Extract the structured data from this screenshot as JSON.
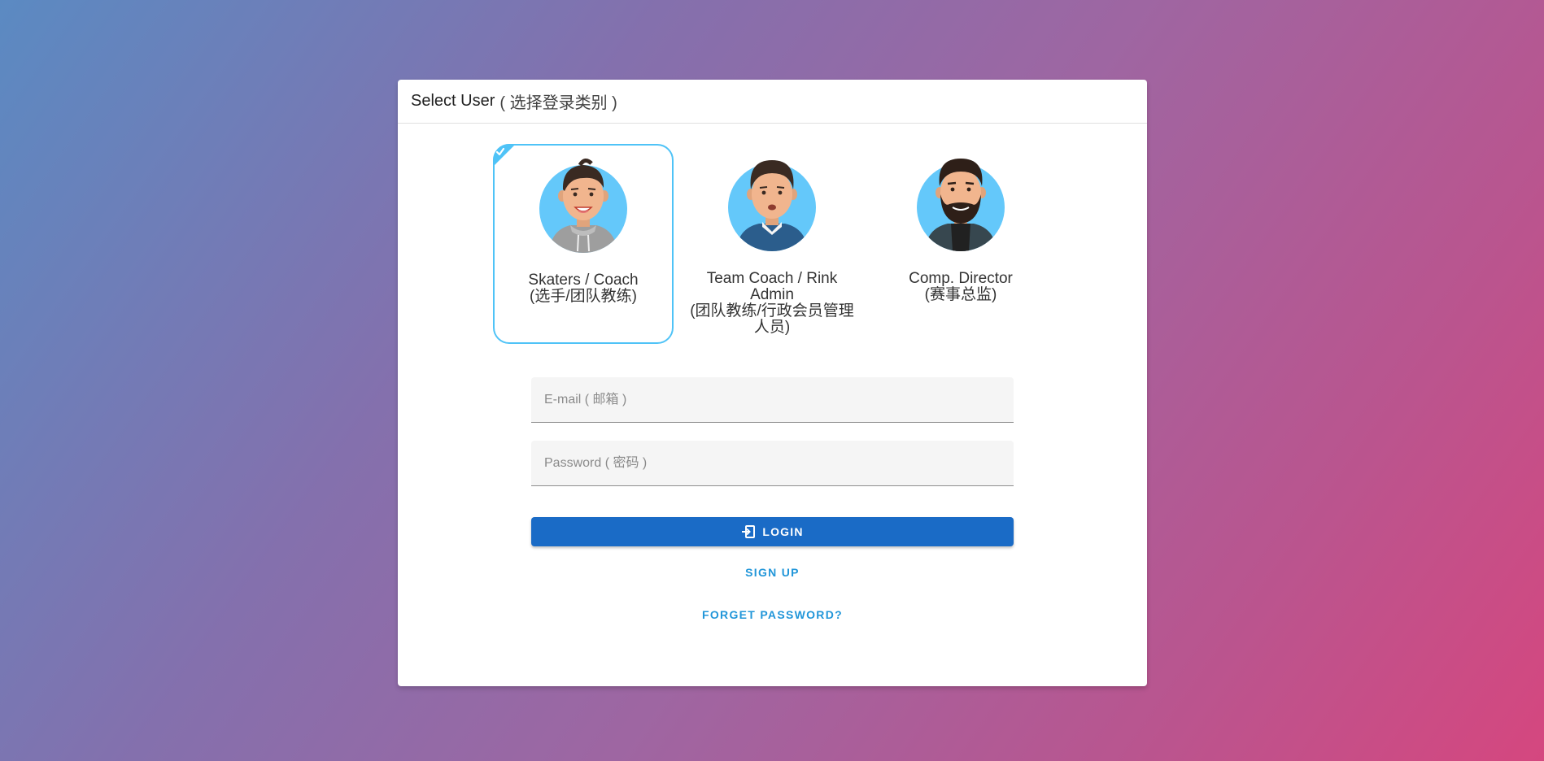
{
  "header": {
    "title": "Select User",
    "subtitle": "( 选择登录类别 )"
  },
  "users": [
    {
      "line1": "Skaters / Coach",
      "line2": "(选手/团队教练)",
      "selected": true,
      "avatar": "young-man-hoodie-avatar"
    },
    {
      "line1": "Team Coach / Rink Admin",
      "line2": "(团队教练/行政会员管理人员)",
      "selected": false,
      "avatar": "man-collared-shirt-avatar"
    },
    {
      "line1": "Comp. Director",
      "line2": "(赛事总监)",
      "selected": false,
      "avatar": "bearded-man-avatar"
    }
  ],
  "form": {
    "email_placeholder": "E-mail ( 邮箱 )",
    "password_placeholder": "Password ( 密码 )",
    "login_label": "LOGIN",
    "signup_label": "SIGN UP",
    "forgot_label": "FORGET PASSWORD?"
  },
  "colors": {
    "accent": "#1a6bc6",
    "link": "#2196d9",
    "selected_border": "#4fc3f7",
    "avatar_bg": "#64c8fa"
  }
}
